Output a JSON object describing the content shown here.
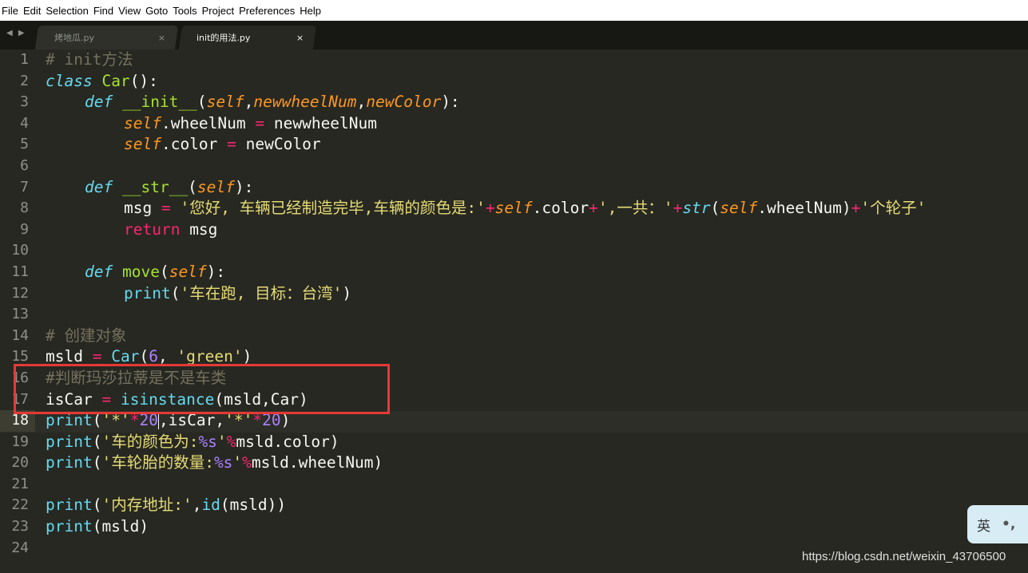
{
  "menu": [
    "File",
    "Edit",
    "Selection",
    "Find",
    "View",
    "Goto",
    "Tools",
    "Project",
    "Preferences",
    "Help"
  ],
  "tabs": [
    {
      "label": "烤地瓜.py",
      "close": "×",
      "active": false
    },
    {
      "label": "init的用法.py",
      "close": "×",
      "active": true
    }
  ],
  "nav_arrows": "◀ ▶",
  "line_numbers": [
    "1",
    "2",
    "3",
    "4",
    "5",
    "6",
    "7",
    "8",
    "9",
    "10",
    "11",
    "12",
    "13",
    "14",
    "15",
    "16",
    "17",
    "18",
    "19",
    "20",
    "21",
    "22",
    "23",
    "24"
  ],
  "current_line": "18",
  "code": {
    "l1_comment": "# init方法",
    "l2_class": "class",
    "l2_name": "Car",
    "l2_tail": "():",
    "l3_def": "def",
    "l3_fn": "__init__",
    "l3_open": "(",
    "l3_self": "self",
    "l3_comma1": ",",
    "l3_p1": "newwheelNum",
    "l3_comma2": ",",
    "l3_p2": "newColor",
    "l3_close": "):",
    "l4_self": "self",
    "l4_rest1": ".wheelNum ",
    "l4_eq": "=",
    "l4_rest2": " newwheelNum",
    "l5_self": "self",
    "l5_rest1": ".color ",
    "l5_eq": "=",
    "l5_rest2": " newColor",
    "l7_def": "def",
    "l7_fn": "__str__",
    "l7_open": "(",
    "l7_self": "self",
    "l7_close": "):",
    "l8_a": "msg ",
    "l8_eq": "=",
    "l8_s1": " '您好, 车辆已经制造完毕,车辆的颜色是:'",
    "l8_plus1": "+",
    "l8_self1": "self",
    "l8_b": ".color",
    "l8_plus2": "+",
    "l8_s2": "',一共：'",
    "l8_plus3": "+",
    "l8_str": "str",
    "l8_open": "(",
    "l8_self2": "self",
    "l8_c": ".wheelNum)",
    "l8_plus4": "+",
    "l8_s3": "'个轮子'",
    "l9_ret": "return",
    "l9_rest": " msg",
    "l11_def": "def",
    "l11_fn": "move",
    "l11_open": "(",
    "l11_self": "self",
    "l11_close": "):",
    "l12_print": "print",
    "l12_open": "(",
    "l12_s": "'车在跑, 目标：台湾'",
    "l12_close": ")",
    "l14_comment": "# 创建对象",
    "l15_a": "msld ",
    "l15_eq": "=",
    "l15_sp": " ",
    "l15_car": "Car",
    "l15_open": "(",
    "l15_num": "6",
    "l15_comma": ", ",
    "l15_s": "'green'",
    "l15_close": ")",
    "l16_comment": "#判断玛莎拉蒂是不是车类",
    "l17_a": "isCar ",
    "l17_eq": "=",
    "l17_sp": " ",
    "l17_fn": "isinstance",
    "l17_rest": "(msld,Car)",
    "l18_print": "print",
    "l18_open": "(",
    "l18_s1": "'*'",
    "l18_star1": "*",
    "l18_n1a": "2",
    "l18_n1b": "0",
    "l18_mid": ",isCar,",
    "l18_s2": "'*'",
    "l18_star2": "*",
    "l18_n2": "20",
    "l18_close": ")",
    "l19_print": "print",
    "l19_open": "(",
    "l19_s1": "'车的颜色为:",
    "l19_fmt": "%s",
    "l19_s2": "'",
    "l19_op": "%",
    "l19_rest": "msld.color)",
    "l20_print": "print",
    "l20_open": "(",
    "l20_s1": "'车轮胎的数量:",
    "l20_fmt": "%s",
    "l20_s2": "'",
    "l20_op": "%",
    "l20_rest": "msld.wheelNum)",
    "l22_print": "print",
    "l22_open": "(",
    "l22_s": "'内存地址:'",
    "l22_comma": ",",
    "l22_id": "id",
    "l22_rest": "(msld))",
    "l23_print": "print",
    "l23_rest": "(msld)"
  },
  "ime": {
    "lang": "英",
    "sep": "•,"
  },
  "watermark": "https://blog.csdn.net/weixin_43706500",
  "colors": {
    "background": "#272822",
    "keyword": "#f92672",
    "string": "#e6db74",
    "function": "#a6e22e",
    "builtin": "#66d9ef",
    "parameter": "#fd971f",
    "number": "#ae81ff",
    "comment": "#75715e",
    "highlight_box": "#e53935"
  }
}
